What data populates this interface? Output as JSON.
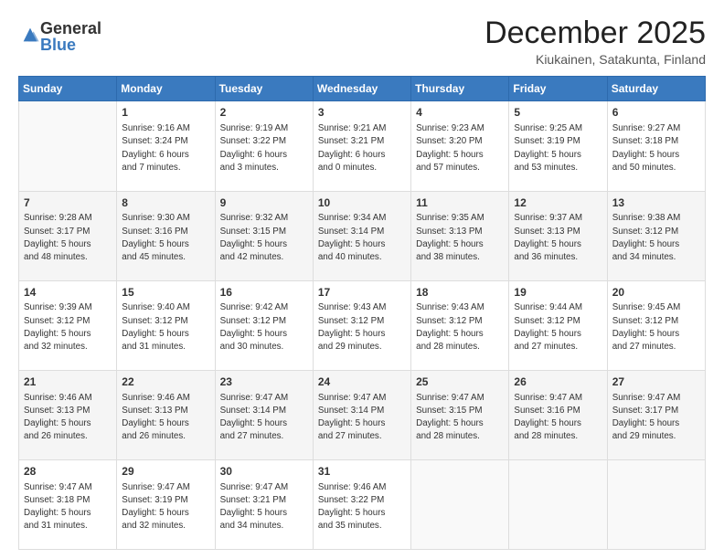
{
  "logo": {
    "general": "General",
    "blue": "Blue"
  },
  "title": "December 2025",
  "location": "Kiukainen, Satakunta, Finland",
  "days_of_week": [
    "Sunday",
    "Monday",
    "Tuesday",
    "Wednesday",
    "Thursday",
    "Friday",
    "Saturday"
  ],
  "weeks": [
    [
      {
        "num": "",
        "info": ""
      },
      {
        "num": "1",
        "info": "Sunrise: 9:16 AM\nSunset: 3:24 PM\nDaylight: 6 hours\nand 7 minutes."
      },
      {
        "num": "2",
        "info": "Sunrise: 9:19 AM\nSunset: 3:22 PM\nDaylight: 6 hours\nand 3 minutes."
      },
      {
        "num": "3",
        "info": "Sunrise: 9:21 AM\nSunset: 3:21 PM\nDaylight: 6 hours\nand 0 minutes."
      },
      {
        "num": "4",
        "info": "Sunrise: 9:23 AM\nSunset: 3:20 PM\nDaylight: 5 hours\nand 57 minutes."
      },
      {
        "num": "5",
        "info": "Sunrise: 9:25 AM\nSunset: 3:19 PM\nDaylight: 5 hours\nand 53 minutes."
      },
      {
        "num": "6",
        "info": "Sunrise: 9:27 AM\nSunset: 3:18 PM\nDaylight: 5 hours\nand 50 minutes."
      }
    ],
    [
      {
        "num": "7",
        "info": "Sunrise: 9:28 AM\nSunset: 3:17 PM\nDaylight: 5 hours\nand 48 minutes."
      },
      {
        "num": "8",
        "info": "Sunrise: 9:30 AM\nSunset: 3:16 PM\nDaylight: 5 hours\nand 45 minutes."
      },
      {
        "num": "9",
        "info": "Sunrise: 9:32 AM\nSunset: 3:15 PM\nDaylight: 5 hours\nand 42 minutes."
      },
      {
        "num": "10",
        "info": "Sunrise: 9:34 AM\nSunset: 3:14 PM\nDaylight: 5 hours\nand 40 minutes."
      },
      {
        "num": "11",
        "info": "Sunrise: 9:35 AM\nSunset: 3:13 PM\nDaylight: 5 hours\nand 38 minutes."
      },
      {
        "num": "12",
        "info": "Sunrise: 9:37 AM\nSunset: 3:13 PM\nDaylight: 5 hours\nand 36 minutes."
      },
      {
        "num": "13",
        "info": "Sunrise: 9:38 AM\nSunset: 3:12 PM\nDaylight: 5 hours\nand 34 minutes."
      }
    ],
    [
      {
        "num": "14",
        "info": "Sunrise: 9:39 AM\nSunset: 3:12 PM\nDaylight: 5 hours\nand 32 minutes."
      },
      {
        "num": "15",
        "info": "Sunrise: 9:40 AM\nSunset: 3:12 PM\nDaylight: 5 hours\nand 31 minutes."
      },
      {
        "num": "16",
        "info": "Sunrise: 9:42 AM\nSunset: 3:12 PM\nDaylight: 5 hours\nand 30 minutes."
      },
      {
        "num": "17",
        "info": "Sunrise: 9:43 AM\nSunset: 3:12 PM\nDaylight: 5 hours\nand 29 minutes."
      },
      {
        "num": "18",
        "info": "Sunrise: 9:43 AM\nSunset: 3:12 PM\nDaylight: 5 hours\nand 28 minutes."
      },
      {
        "num": "19",
        "info": "Sunrise: 9:44 AM\nSunset: 3:12 PM\nDaylight: 5 hours\nand 27 minutes."
      },
      {
        "num": "20",
        "info": "Sunrise: 9:45 AM\nSunset: 3:12 PM\nDaylight: 5 hours\nand 27 minutes."
      }
    ],
    [
      {
        "num": "21",
        "info": "Sunrise: 9:46 AM\nSunset: 3:13 PM\nDaylight: 5 hours\nand 26 minutes."
      },
      {
        "num": "22",
        "info": "Sunrise: 9:46 AM\nSunset: 3:13 PM\nDaylight: 5 hours\nand 26 minutes."
      },
      {
        "num": "23",
        "info": "Sunrise: 9:47 AM\nSunset: 3:14 PM\nDaylight: 5 hours\nand 27 minutes."
      },
      {
        "num": "24",
        "info": "Sunrise: 9:47 AM\nSunset: 3:14 PM\nDaylight: 5 hours\nand 27 minutes."
      },
      {
        "num": "25",
        "info": "Sunrise: 9:47 AM\nSunset: 3:15 PM\nDaylight: 5 hours\nand 28 minutes."
      },
      {
        "num": "26",
        "info": "Sunrise: 9:47 AM\nSunset: 3:16 PM\nDaylight: 5 hours\nand 28 minutes."
      },
      {
        "num": "27",
        "info": "Sunrise: 9:47 AM\nSunset: 3:17 PM\nDaylight: 5 hours\nand 29 minutes."
      }
    ],
    [
      {
        "num": "28",
        "info": "Sunrise: 9:47 AM\nSunset: 3:18 PM\nDaylight: 5 hours\nand 31 minutes."
      },
      {
        "num": "29",
        "info": "Sunrise: 9:47 AM\nSunset: 3:19 PM\nDaylight: 5 hours\nand 32 minutes."
      },
      {
        "num": "30",
        "info": "Sunrise: 9:47 AM\nSunset: 3:21 PM\nDaylight: 5 hours\nand 34 minutes."
      },
      {
        "num": "31",
        "info": "Sunrise: 9:46 AM\nSunset: 3:22 PM\nDaylight: 5 hours\nand 35 minutes."
      },
      {
        "num": "",
        "info": ""
      },
      {
        "num": "",
        "info": ""
      },
      {
        "num": "",
        "info": ""
      }
    ]
  ]
}
